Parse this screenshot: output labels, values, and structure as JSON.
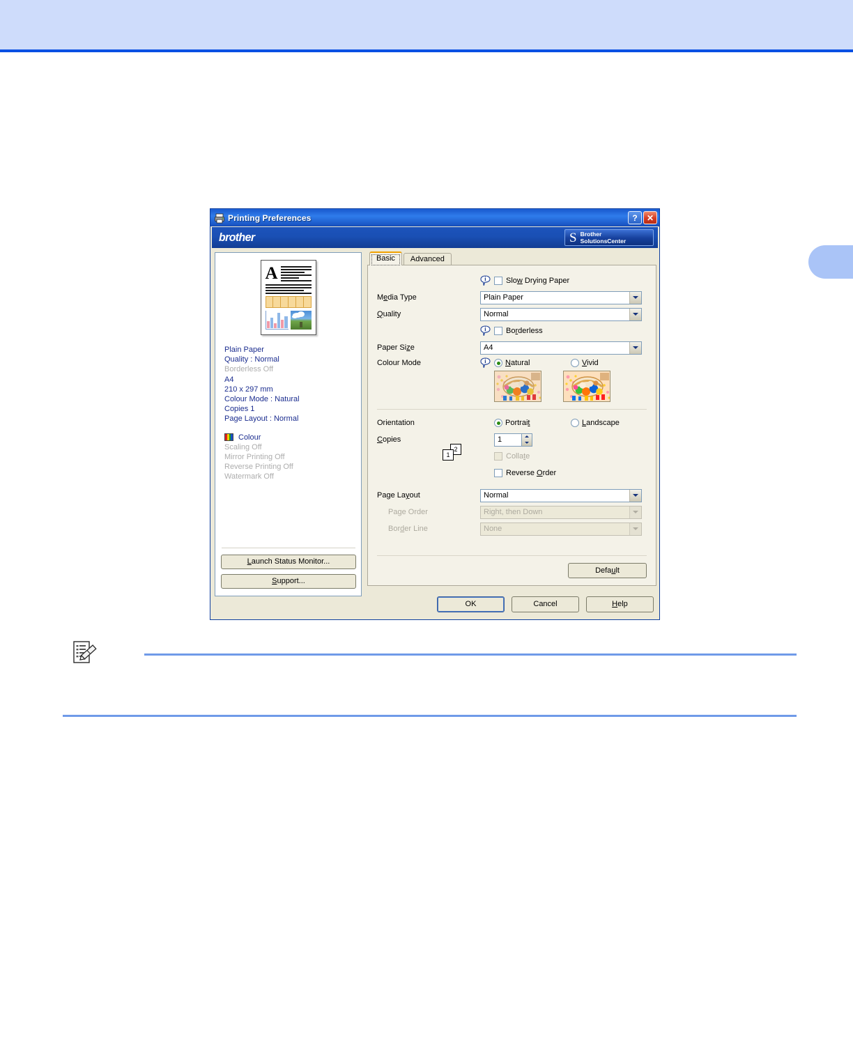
{
  "manual": {
    "note_icon": "note-pencil-icon"
  },
  "dialog": {
    "title": "Printing Preferences",
    "titlebar_icon": "printer-icon",
    "help_button": "?",
    "close_button": "✕",
    "brand": "brother",
    "solutions_center": {
      "line1": "Brother",
      "line2": "SolutionsCenter",
      "swoosh": "S"
    }
  },
  "preview": {
    "thumbnail_letter": "A",
    "summary": [
      {
        "text": "Plain Paper",
        "state": "on"
      },
      {
        "text": "Quality : Normal",
        "state": "on"
      },
      {
        "text": "Borderless Off",
        "state": "off"
      },
      {
        "text": "A4",
        "state": "on"
      },
      {
        "text": "210 x 297 mm",
        "state": "on"
      },
      {
        "text": "Colour Mode : Natural",
        "state": "on"
      },
      {
        "text": "Copies 1",
        "state": "on"
      },
      {
        "text": "Page Layout : Normal",
        "state": "on"
      }
    ],
    "colour_label": "Colour",
    "summary2": [
      {
        "text": "Scaling Off",
        "state": "off"
      },
      {
        "text": "Mirror Printing Off",
        "state": "off"
      },
      {
        "text": "Reverse Printing Off",
        "state": "off"
      },
      {
        "text": "Watermark Off",
        "state": "off"
      }
    ],
    "buttons": {
      "status_monitor": "Launch Status Monitor...",
      "support": "Support..."
    }
  },
  "tabs": [
    {
      "label": "Basic",
      "active": true
    },
    {
      "label": "Advanced",
      "active": false
    }
  ],
  "settings": {
    "slow_drying_paper": {
      "label": "Slow Drying Paper",
      "checked": false
    },
    "media_type": {
      "label": "Media Type",
      "value": "Plain Paper"
    },
    "quality": {
      "label": "Quality",
      "value": "Normal"
    },
    "borderless": {
      "label": "Borderless",
      "checked": false
    },
    "paper_size": {
      "label": "Paper Size",
      "value": "A4"
    },
    "colour_mode": {
      "label": "Colour Mode",
      "options": [
        {
          "label": "Natural",
          "selected": true
        },
        {
          "label": "Vivid",
          "selected": false
        }
      ]
    },
    "orientation": {
      "label": "Orientation",
      "options": [
        {
          "label": "Portrait",
          "selected": true
        },
        {
          "label": "Landscape",
          "selected": false
        }
      ]
    },
    "copies": {
      "label": "Copies",
      "value": "1"
    },
    "collate": {
      "label": "Collate",
      "checked": false,
      "disabled": true
    },
    "reverse_order": {
      "label": "Reverse Order",
      "checked": false
    },
    "page_icon": {
      "first": "1",
      "second": "2"
    },
    "page_layout": {
      "label": "Page Layout",
      "value": "Normal"
    },
    "page_order": {
      "label": "Page Order",
      "value": "Right, then Down",
      "disabled": true
    },
    "border_line": {
      "label": "Border Line",
      "value": "None",
      "disabled": true
    }
  },
  "buttons": {
    "default": "Default",
    "ok": "OK",
    "cancel": "Cancel",
    "help": "Help"
  },
  "colors": {
    "titlebar_blue": "#1d5fd2",
    "banner_blue": "#143f99",
    "dialog_face": "#ece9d8",
    "summary_text": "#1b2d8f",
    "summary_disabled": "#adadad",
    "tab_accent": "#f0a202",
    "page_band": "#cedcfb",
    "page_rule": "#0a50e3"
  }
}
